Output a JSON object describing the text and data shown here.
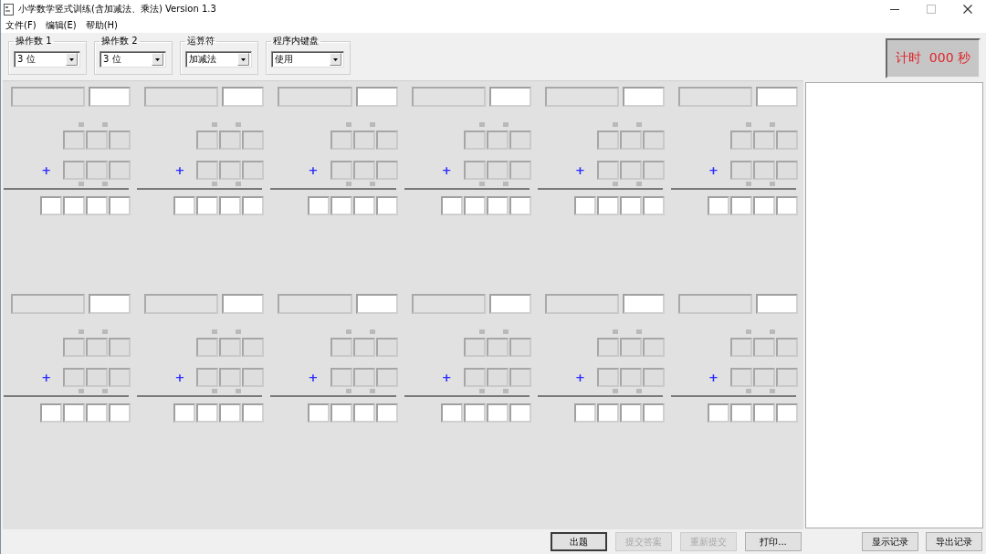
{
  "window": {
    "title": "小学数学竖式训练(含加减法、乘法) Version 1.3"
  },
  "menu": [
    {
      "label": "文件(F)"
    },
    {
      "label": "编辑(E)"
    },
    {
      "label": "帮助(H)"
    }
  ],
  "options": [
    {
      "label": "操作数 1",
      "value": "3 位"
    },
    {
      "label": "操作数 2",
      "value": "3 位"
    },
    {
      "label": "运算符",
      "value": "加减法"
    },
    {
      "label": "程序内键盘",
      "value": "使用"
    }
  ],
  "timer": "计时  000 秒",
  "problems": [
    {
      "operator": "+"
    },
    {
      "operator": "+"
    },
    {
      "operator": "+"
    },
    {
      "operator": "+"
    },
    {
      "operator": "+"
    },
    {
      "operator": "+"
    },
    {
      "operator": "+"
    },
    {
      "operator": "+"
    },
    {
      "operator": "+"
    },
    {
      "operator": "+"
    },
    {
      "operator": "+"
    },
    {
      "operator": "+"
    }
  ],
  "buttons": [
    {
      "label": "出题",
      "disabled": false,
      "default": true
    },
    {
      "label": "提交答案",
      "disabled": true,
      "default": false
    },
    {
      "label": "重新提交",
      "disabled": true,
      "default": false
    },
    {
      "label": "打印...",
      "disabled": false,
      "default": false
    }
  ],
  "record_buttons": [
    {
      "label": "显示记录",
      "disabled": false,
      "default": false
    },
    {
      "label": "导出记录",
      "disabled": false,
      "default": false
    }
  ]
}
